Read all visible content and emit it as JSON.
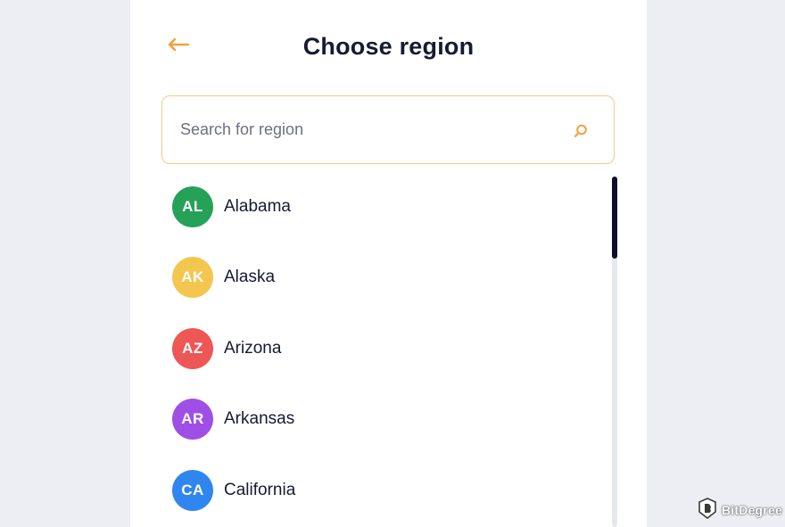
{
  "header": {
    "title": "Choose region",
    "back_icon": "arrow-left-icon"
  },
  "search": {
    "placeholder": "Search for region",
    "value": "",
    "icon": "search-icon"
  },
  "regions": [
    {
      "code": "AL",
      "name": "Alabama",
      "color": "#26a158"
    },
    {
      "code": "AK",
      "name": "Alaska",
      "color": "#f3c74f"
    },
    {
      "code": "AZ",
      "name": "Arizona",
      "color": "#ef5656"
    },
    {
      "code": "AR",
      "name": "Arkansas",
      "color": "#a04fe6"
    },
    {
      "code": "CA",
      "name": "California",
      "color": "#2f86ef"
    }
  ],
  "colors": {
    "accent": "#f2a23c",
    "search_border": "#f7c88a",
    "title": "#161a33",
    "scroll_thumb": "#0d1028",
    "background": "#eceef3"
  },
  "watermark": {
    "text": "BitDegree",
    "icon": "bitdegree-logo-icon"
  }
}
